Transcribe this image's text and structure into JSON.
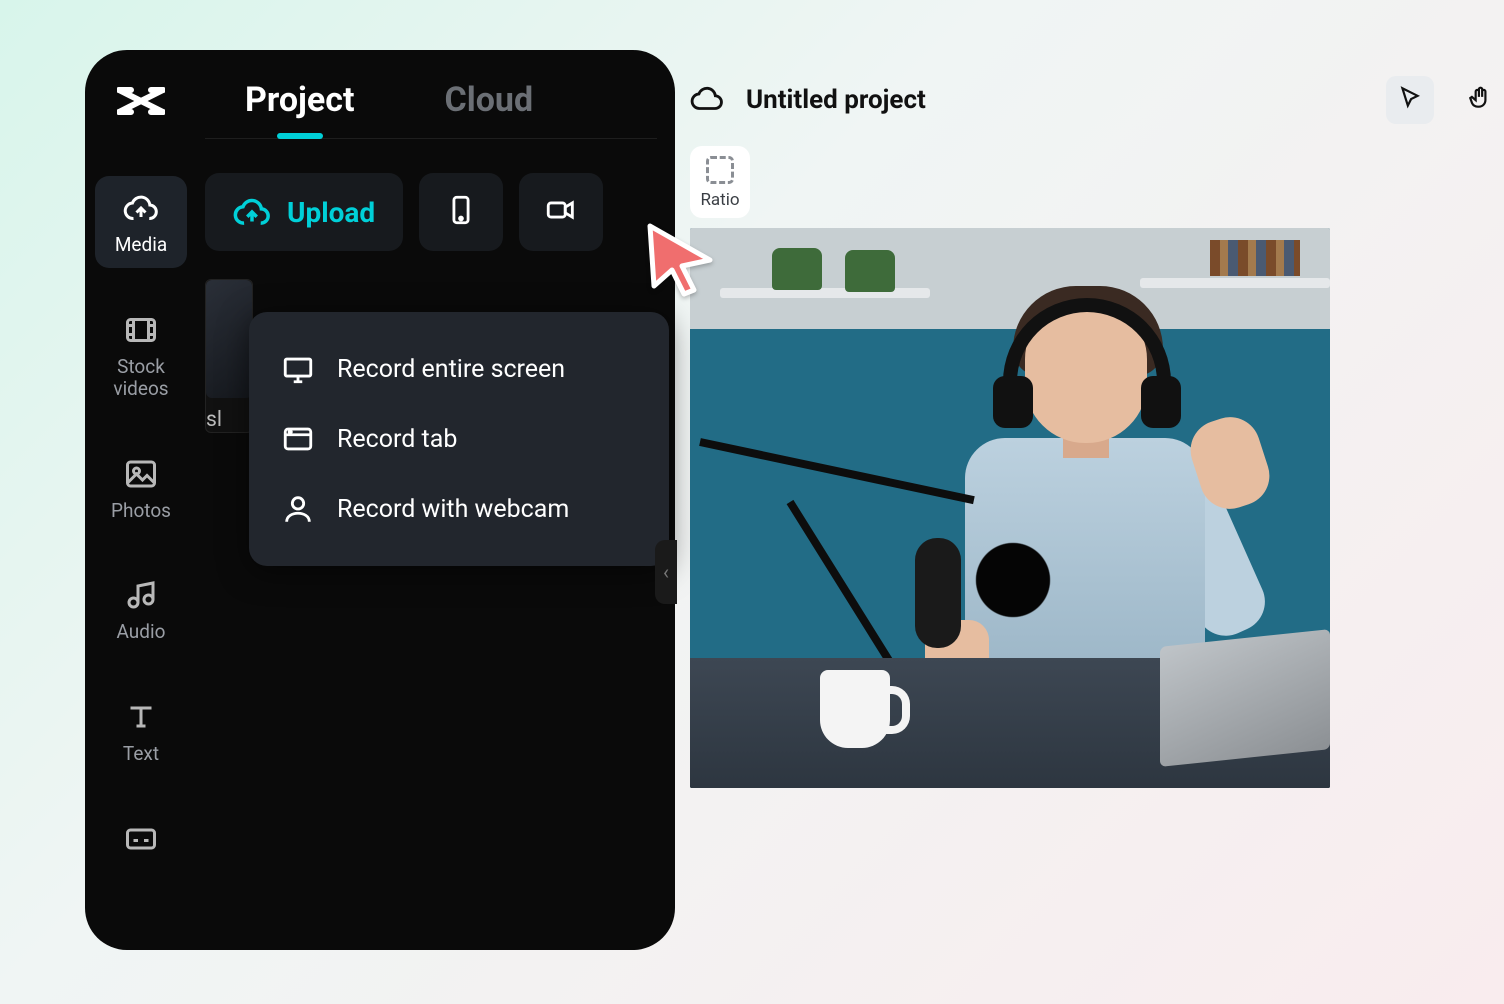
{
  "sidebar": {
    "items": [
      {
        "label": "Media"
      },
      {
        "label": "Stock\nvideos"
      },
      {
        "label": "Photos"
      },
      {
        "label": "Audio"
      },
      {
        "label": "Text"
      }
    ]
  },
  "tabs": {
    "project": "Project",
    "cloud": "Cloud"
  },
  "upload": {
    "label": "Upload"
  },
  "thumb": {
    "label": "sl"
  },
  "dropdown": {
    "items": [
      {
        "label": "Record entire screen"
      },
      {
        "label": "Record tab"
      },
      {
        "label": "Record with webcam"
      }
    ]
  },
  "canvas": {
    "project_title": "Untitled project",
    "ratio_label": "Ratio"
  }
}
